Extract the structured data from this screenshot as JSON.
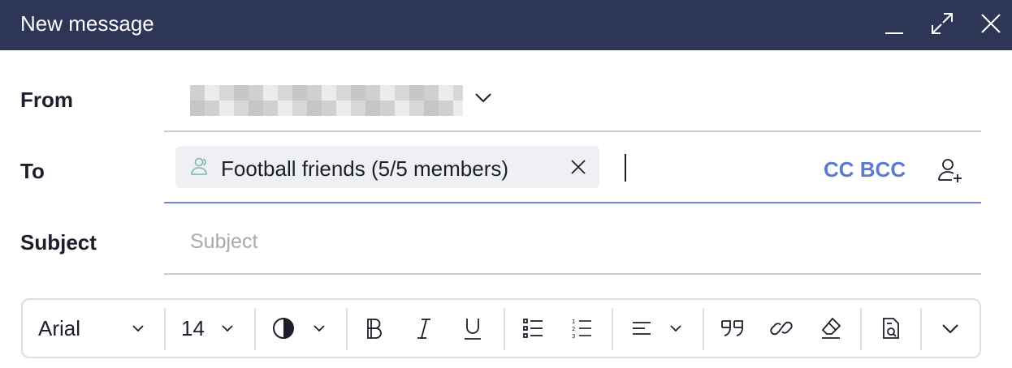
{
  "window": {
    "title": "New message",
    "controls": [
      "minimize-icon",
      "expand-icon",
      "close-icon"
    ]
  },
  "from": {
    "label": "From"
  },
  "to": {
    "label": "To",
    "recipients": [
      {
        "label": "Football friends (5/5 members)",
        "icon": "group-icon"
      }
    ],
    "cc_bcc_label": "CC BCC"
  },
  "subject": {
    "label": "Subject",
    "placeholder": "Subject",
    "value": ""
  },
  "toolbar": {
    "font_family": "Arial",
    "font_size": "14",
    "items": [
      "color-icon",
      "bold-icon",
      "italic-icon",
      "underline-icon",
      "bulleted-list-icon",
      "numbered-list-icon",
      "align-left-icon",
      "quote-icon",
      "link-icon",
      "clear-format-icon",
      "template-icon",
      "more-icon"
    ]
  },
  "colors": {
    "titlebar": "#2e3658",
    "accent": "#5b7ad6",
    "active_underline": "#6f86d6",
    "chip_background": "#eef0f3"
  }
}
